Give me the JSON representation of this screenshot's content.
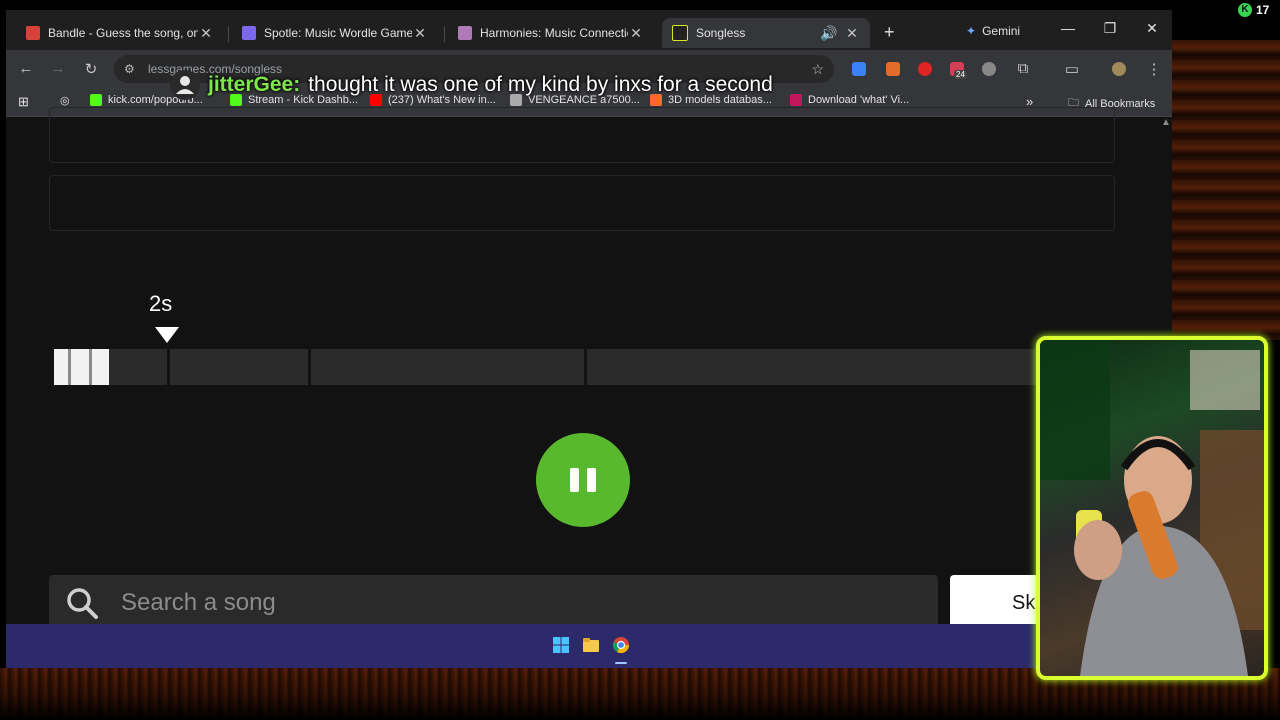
{
  "tabs": [
    {
      "title": "Bandle - Guess the song, one i",
      "favicon_color": "#d9423a",
      "active": false
    },
    {
      "title": "Spotle: Music Wordle Game",
      "favicon_color": "#7b68ee",
      "active": false
    },
    {
      "title": "Harmonies: Music Connections",
      "favicon_color": "#b07ab8",
      "active": false
    },
    {
      "title": "Songless",
      "favicon_color": "#d6e81c",
      "active": true
    }
  ],
  "gemini_label": "Gemini",
  "address_bar": {
    "url": "lessgames.com/songless"
  },
  "extension_badge": "24",
  "bookmarks": [
    {
      "label": "kick.com/popou/b...",
      "color": "#53fc18"
    },
    {
      "label": "Stream - Kick Dashb...",
      "color": "#53fc18"
    },
    {
      "label": "(237) What's New in...",
      "color": "#ff0000"
    },
    {
      "label": "VENGEANCE a7500...",
      "color": "#aaaaaa"
    },
    {
      "label": "3D models databas...",
      "color": "#ff6a2c"
    },
    {
      "label": "Download 'what' Vi...",
      "color": "#c2185b"
    }
  ],
  "all_bookmarks_label": "All Bookmarks",
  "game": {
    "time_label": "2s",
    "progress_fraction": 0.052,
    "segment_boundaries": [
      0.107,
      0.24,
      0.5,
      1.0
    ],
    "search_placeholder": "Search a song",
    "skip_label": "Sk",
    "accent_color": "#59b92e"
  },
  "chat": {
    "username": "jitterGee:",
    "message": "thought it was one of my kind by inxs for a second",
    "username_color": "#7ee64a"
  },
  "viewer_count": "17",
  "webcam_border_color": "#d9ff2e"
}
